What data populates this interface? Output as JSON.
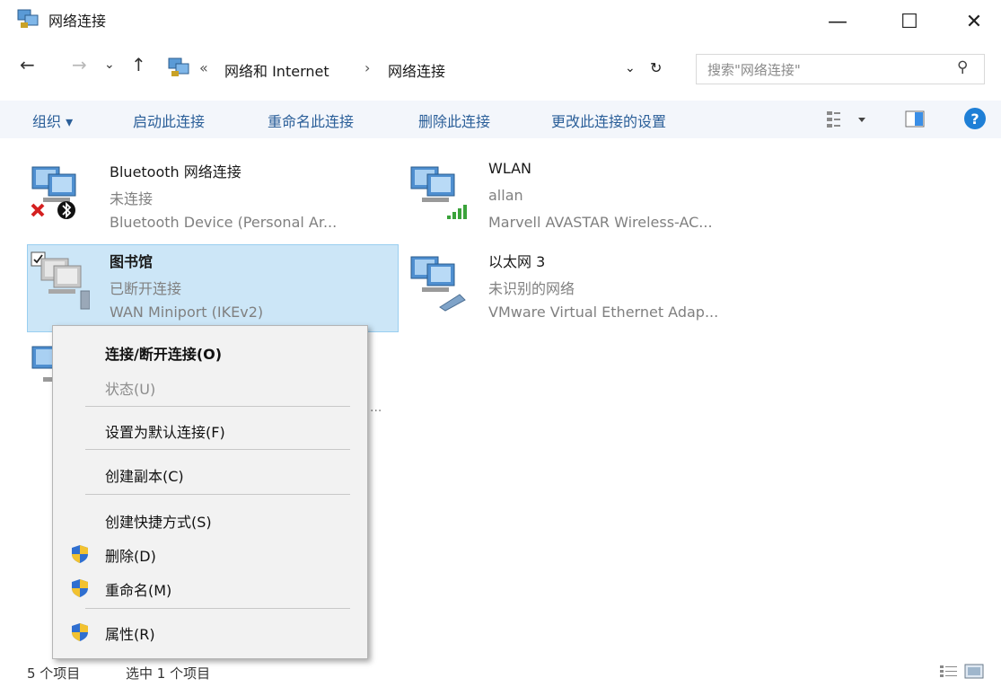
{
  "window": {
    "title": "网络连接",
    "minimize": "—",
    "maximize": "☐",
    "close": "✕"
  },
  "address": {
    "back": "←",
    "forward": "→",
    "recent": "⌄",
    "up": "↑",
    "overflow": "«",
    "crumbs": [
      "网络和 Internet",
      "网络连接"
    ],
    "separator": "›",
    "dropdown": "⌄",
    "refresh": "↻",
    "search_placeholder": "搜索\"网络连接\"",
    "search_icon_glyph": "⚲"
  },
  "toolbar": {
    "organize": "组织 ▾",
    "start": "启动此连接",
    "rename": "重命名此连接",
    "delete": "删除此连接",
    "change": "更改此连接的设置",
    "help": "?"
  },
  "connections": [
    {
      "name": "Bluetooth 网络连接",
      "status": "未连接",
      "device": "Bluetooth Device (Personal Ar...",
      "icon": "bluetooth-network-icon"
    },
    {
      "name": "WLAN",
      "status": "allan",
      "device": "Marvell AVASTAR Wireless-AC...",
      "icon": "wifi-network-icon"
    },
    {
      "name": "图书馆",
      "status": "已断开连接",
      "device": "WAN Miniport (IKEv2)",
      "icon": "vpn-network-icon"
    },
    {
      "name": "以太网 3",
      "status": "未识别的网络",
      "device": "VMware Virtual Ethernet Adap...",
      "icon": "ethernet-network-icon"
    },
    {
      "name": "",
      "status": "",
      "device": "...",
      "icon": "network-icon"
    }
  ],
  "context_menu": {
    "connect": "连接/断开连接(O)",
    "status": "状态(U)",
    "set_default": "设置为默认连接(F)",
    "copy": "创建副本(C)",
    "shortcut": "创建快捷方式(S)",
    "delete": "删除(D)",
    "rename": "重命名(M)",
    "properties": "属性(R)"
  },
  "statusbar": {
    "count": "5 个项目",
    "selected": "选中 1 个项目"
  },
  "colors": {
    "accent": "#2b5f99",
    "selection": "#cce6f7",
    "help": "#1e7fd6"
  }
}
